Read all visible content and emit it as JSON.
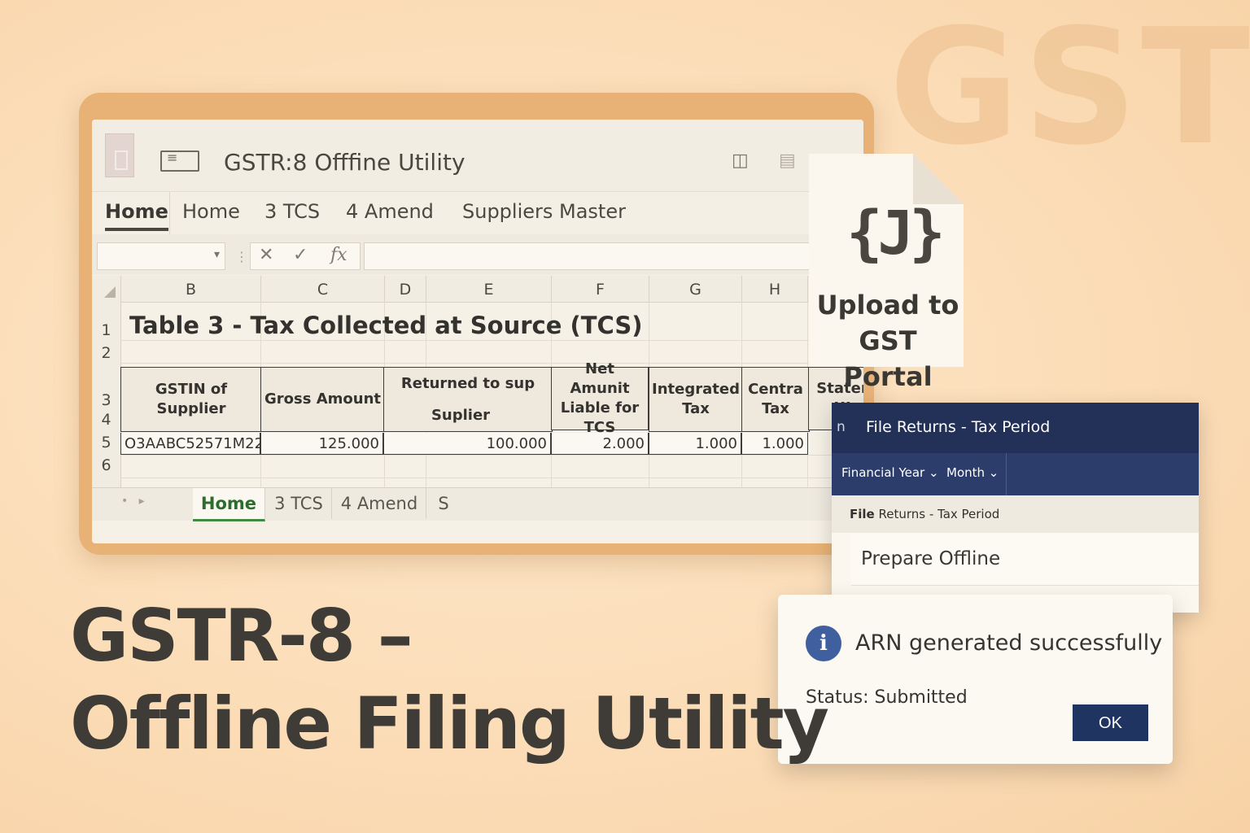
{
  "watermark": "GST",
  "window": {
    "title": "GSTR:8  Offfine Utility",
    "ribbon_tabs": [
      "Home",
      "Home",
      "3 TCS",
      "4 Amend",
      "Suppliers Master"
    ]
  },
  "formula_bar": {
    "buttons": [
      "✕",
      "✓",
      "fx"
    ]
  },
  "sheet": {
    "columns": [
      "B",
      "C",
      "D",
      "E",
      "F",
      "G",
      "H"
    ],
    "rows": [
      "1",
      "2",
      "3",
      "4",
      "5",
      "6"
    ],
    "title": "Table 3 - Tax Collected at Source (TCS)",
    "headers": {
      "gstin": "GSTIN of Supplier",
      "gross": "Gross Amount",
      "returned_top": "Returned to sup",
      "returned_bottom": "Suplier",
      "net": "Net Amunit Liable for TCS",
      "integrated": "Integrated Tax",
      "central": "Centra Tax",
      "state": "Stater UI"
    },
    "row5": {
      "gstin": "O3AABC52571M22",
      "gross": "125.000",
      "returned": "100.000",
      "net": "2.000",
      "integrated": "1.000",
      "central": "1.000"
    },
    "tabs": [
      "Home",
      "3 TCS",
      "4 Amend",
      "S"
    ]
  },
  "upload_card": {
    "icon": "{J}",
    "label": "Upload to GST Portal"
  },
  "file_returns": {
    "header_prefix": "n",
    "header": "File Returns - Tax Period",
    "nav": [
      "Financial Year ⌄",
      "Month ⌄"
    ],
    "breadcrumb_bold": "File",
    "breadcrumb_rest": " Returns - Tax Period",
    "item": "Prepare Offline"
  },
  "dialog": {
    "message": "ARN generated successfully",
    "status": "Status: Submitted",
    "ok": "OK"
  },
  "headline": {
    "line1": "GSTR-8 –",
    "line2": "Offline Filing Utility"
  }
}
